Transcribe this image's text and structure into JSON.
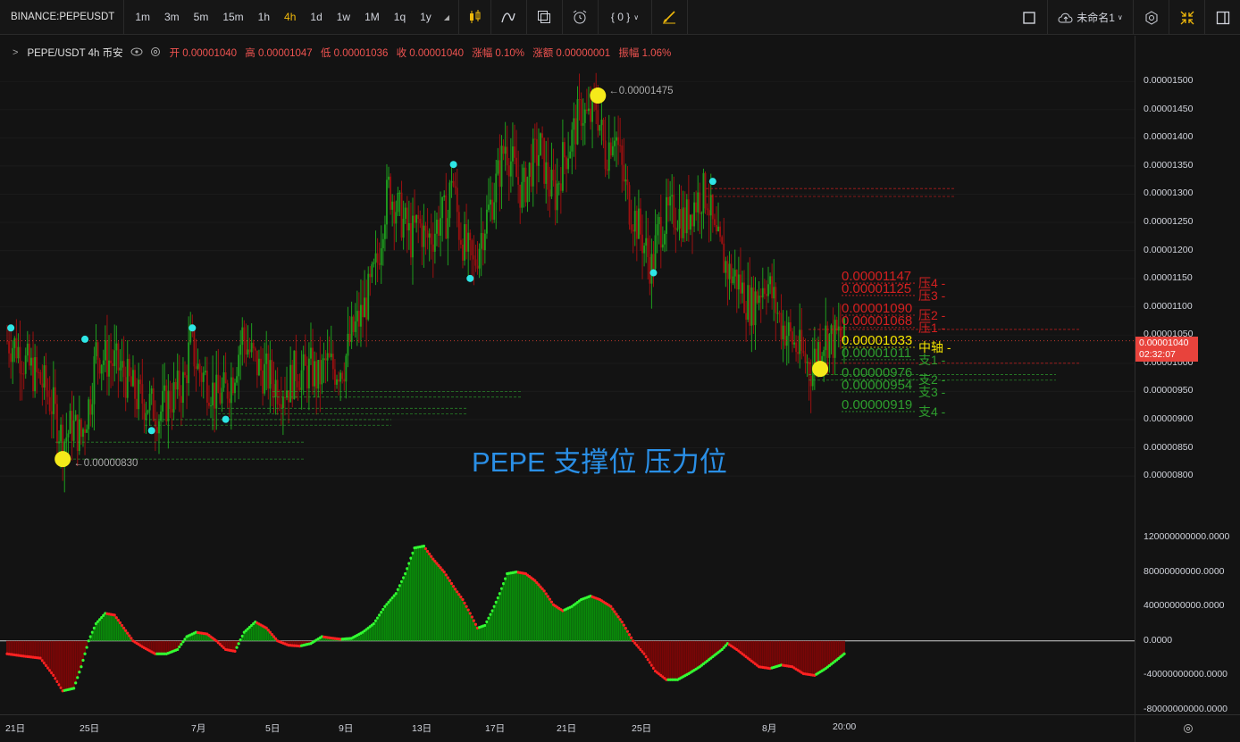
{
  "toolbar": {
    "symbol": "BINANCE:PEPEUSDT",
    "intervals": [
      "1m",
      "3m",
      "5m",
      "15m",
      "1h",
      "4h",
      "1d",
      "1w",
      "1M",
      "1q",
      "1y"
    ],
    "active_interval": "4h",
    "indicator_count": "{ 0 }",
    "layout_name": "未命名1"
  },
  "legend": {
    "title": "PEPE/USDT 4h 币安",
    "open": "开 0.00001040",
    "high": "高 0.00001047",
    "low": "低 0.00001036",
    "close": "收 0.00001040",
    "change": "涨幅 0.10%",
    "amount": "涨额 0.00000001",
    "amplitude": "振幅 1.06%"
  },
  "colors": {
    "up": "#1e9e1e",
    "down": "#9b1010",
    "resistance": "#d42020",
    "support": "#2e9e2e",
    "pivot": "#f5e400",
    "marker_cyan": "#2ee6e6",
    "marker_yellow": "#f5ea1a",
    "watermark": "#2a8fe6"
  },
  "watermark": "PEPE   支撑位  压力位",
  "current_price": {
    "value": "0.00001040",
    "countdown": "02:32:07"
  },
  "chart_data": [
    {
      "type": "candlestick",
      "yaxis_ticks": [
        "0.00001500",
        "0.00001450",
        "0.00001400",
        "0.00001350",
        "0.00001300",
        "0.00001250",
        "0.00001200",
        "0.00001150",
        "0.00001100",
        "0.00001050",
        "0.00001000",
        "0.00000950",
        "0.00000900",
        "0.00000850",
        "0.00000800"
      ],
      "ylim": [
        7.7e-06,
        1.54e-05
      ],
      "xaxis_ticks": [
        "21日",
        "25日",
        "7月",
        "5日",
        "9日",
        "13日",
        "17日",
        "21日",
        "25日",
        "8月",
        "20:00"
      ],
      "close_path": [
        [
          0,
          1.04e-05
        ],
        [
          5,
          1.03e-05
        ],
        [
          10,
          1e-05
        ],
        [
          15,
          9.8e-06
        ],
        [
          20,
          9.6e-06
        ],
        [
          25,
          9.2e-06
        ],
        [
          30,
          8.6e-06
        ],
        [
          35,
          8.9e-06
        ],
        [
          40,
          8.7e-06
        ],
        [
          45,
          9.4e-06
        ],
        [
          48,
          1.02e-05
        ],
        [
          52,
          1.01e-05
        ],
        [
          58,
          1e-05
        ],
        [
          63,
          9.8e-06
        ],
        [
          70,
          9.4e-06
        ],
        [
          76,
          9.3e-06
        ],
        [
          82,
          9.1e-06
        ],
        [
          86,
          9.3e-06
        ],
        [
          92,
          9.5e-06
        ],
        [
          96,
          9.7e-06
        ],
        [
          99,
          1.04e-05
        ],
        [
          103,
          9.9e-06
        ],
        [
          108,
          9.7e-06
        ],
        [
          113,
          9.4e-06
        ],
        [
          118,
          9.5e-06
        ],
        [
          122,
          9.8e-06
        ],
        [
          127,
          1.05e-05
        ],
        [
          131,
          1.02e-05
        ],
        [
          136,
          9.9e-06
        ],
        [
          140,
          9.8e-06
        ],
        [
          146,
          9.6e-06
        ],
        [
          152,
          9.6e-06
        ],
        [
          156,
          9.9e-06
        ],
        [
          160,
          9.8e-06
        ],
        [
          164,
          9.9e-06
        ],
        [
          168,
          9.7e-06
        ],
        [
          172,
          1e-05
        ],
        [
          177,
          9.9e-06
        ],
        [
          182,
          1e-05
        ],
        [
          186,
          1.05e-05
        ],
        [
          192,
          1.09e-05
        ],
        [
          196,
          1.13e-05
        ],
        [
          200,
          1.18e-05
        ],
        [
          203,
          1.26e-05
        ],
        [
          206,
          1.31e-05
        ],
        [
          210,
          1.28e-05
        ],
        [
          214,
          1.25e-05
        ],
        [
          218,
          1.22e-05
        ],
        [
          222,
          1.25e-05
        ],
        [
          226,
          1.22e-05
        ],
        [
          230,
          1.23e-05
        ],
        [
          234,
          1.26e-05
        ],
        [
          238,
          1.26e-05
        ],
        [
          240,
          1.34e-05
        ],
        [
          244,
          1.24e-05
        ],
        [
          248,
          1.2e-05
        ],
        [
          252,
          1.17e-05
        ],
        [
          256,
          1.23e-05
        ],
        [
          261,
          1.28e-05
        ],
        [
          265,
          1.33e-05
        ],
        [
          269,
          1.39e-05
        ],
        [
          273,
          1.35e-05
        ],
        [
          278,
          1.3e-05
        ],
        [
          284,
          1.36e-05
        ],
        [
          288,
          1.38e-05
        ],
        [
          292,
          1.32e-05
        ],
        [
          296,
          1.3e-05
        ],
        [
          300,
          1.36e-05
        ],
        [
          305,
          1.4e-05
        ],
        [
          310,
          1.45e-05
        ],
        [
          314,
          1.43e-05
        ],
        [
          318,
          1.46e-05
        ],
        [
          323,
          1.37e-05
        ],
        [
          328,
          1.42e-05
        ],
        [
          332,
          1.34e-05
        ],
        [
          336,
          1.28e-05
        ],
        [
          340,
          1.25e-05
        ],
        [
          344,
          1.21e-05
        ],
        [
          348,
          1.17e-05
        ],
        [
          352,
          1.24e-05
        ],
        [
          357,
          1.26e-05
        ],
        [
          362,
          1.27e-05
        ],
        [
          366,
          1.25e-05
        ],
        [
          370,
          1.28e-05
        ],
        [
          375,
          1.3e-05
        ],
        [
          378,
          1.3e-05
        ],
        [
          382,
          1.22e-05
        ],
        [
          386,
          1.19e-05
        ],
        [
          390,
          1.16e-05
        ],
        [
          394,
          1.15e-05
        ],
        [
          398,
          1.12e-05
        ],
        [
          402,
          1.1e-05
        ],
        [
          406,
          1.13e-05
        ],
        [
          410,
          1.15e-05
        ],
        [
          414,
          1.11e-05
        ],
        [
          418,
          1.07e-05
        ],
        [
          422,
          1.05e-05
        ],
        [
          426,
          1.03e-05
        ],
        [
          430,
          1.01e-05
        ],
        [
          434,
          9.9e-06
        ],
        [
          438,
          1.03e-05
        ],
        [
          442,
          1.05e-05
        ],
        [
          446,
          1.04e-05
        ],
        [
          449,
          1.05e-05
        ],
        [
          452,
          1.04e-05
        ]
      ],
      "candle_count": 453,
      "annotations": {
        "low": {
          "label": "0.00000830",
          "index": 30,
          "value": 8.3e-06
        },
        "high": {
          "label": "0.00001475",
          "index": 319,
          "value": 1.475e-05
        }
      },
      "swing_markers": {
        "yellow": [
          [
            30,
            8.3e-06
          ],
          [
            319,
            1.475e-05
          ],
          [
            439,
            9.9e-06
          ]
        ],
        "cyan_top": [
          [
            2,
            1.05e-05
          ],
          [
            42,
            1.03e-05
          ],
          [
            100,
            1.05e-05
          ],
          [
            241,
            1.34e-05
          ],
          [
            381,
            1.31e-05
          ]
        ],
        "cyan_bottom": [
          [
            78,
            8.9e-06
          ],
          [
            118,
            9.1e-06
          ],
          [
            250,
            1.16e-05
          ],
          [
            349,
            1.17e-05
          ]
        ]
      },
      "levels": [
        {
          "label": "压4",
          "value": "0.00001147",
          "price": 1.147e-05,
          "kind": "resistance"
        },
        {
          "label": "压3",
          "value": "0.00001125",
          "price": 1.125e-05,
          "kind": "resistance"
        },
        {
          "label": "压2",
          "value": "0.00001090",
          "price": 1.09e-05,
          "kind": "resistance"
        },
        {
          "label": "压1",
          "value": "0.00001068",
          "price": 1.068e-05,
          "kind": "resistance"
        },
        {
          "label": "中轴",
          "value": "0.00001033",
          "price": 1.033e-05,
          "kind": "pivot"
        },
        {
          "label": "支1",
          "value": "0.00001011",
          "price": 1.011e-05,
          "kind": "support"
        },
        {
          "label": "支2",
          "value": "0.00000976",
          "price": 9.76e-06,
          "kind": "support"
        },
        {
          "label": "支3",
          "value": "0.00000954",
          "price": 9.54e-06,
          "kind": "support"
        },
        {
          "label": "支4",
          "value": "0.00000919",
          "price": 9.19e-06,
          "kind": "support"
        }
      ]
    },
    {
      "type": "bar",
      "name": "MACD histogram",
      "yaxis_ticks": [
        "120000000000.0000",
        "80000000000.0000",
        "40000000000.0000",
        "0.0000",
        "-40000000000.0000",
        "-80000000000.0000"
      ],
      "ylim": [
        -80000000000,
        120000000000
      ],
      "histogram_path": [
        [
          0,
          -15
        ],
        [
          10,
          -18
        ],
        [
          18,
          -20
        ],
        [
          25,
          -40
        ],
        [
          30,
          -58
        ],
        [
          36,
          -55
        ],
        [
          40,
          -30
        ],
        [
          44,
          0
        ],
        [
          48,
          20
        ],
        [
          53,
          32
        ],
        [
          58,
          30
        ],
        [
          63,
          15
        ],
        [
          68,
          0
        ],
        [
          74,
          -8
        ],
        [
          80,
          -15
        ],
        [
          86,
          -15
        ],
        [
          92,
          -10
        ],
        [
          97,
          5
        ],
        [
          102,
          10
        ],
        [
          108,
          8
        ],
        [
          113,
          0
        ],
        [
          118,
          -10
        ],
        [
          123,
          -12
        ],
        [
          128,
          10
        ],
        [
          134,
          22
        ],
        [
          140,
          15
        ],
        [
          146,
          0
        ],
        [
          152,
          -5
        ],
        [
          158,
          -6
        ],
        [
          164,
          -3
        ],
        [
          170,
          5
        ],
        [
          176,
          3
        ],
        [
          180,
          2
        ],
        [
          186,
          3
        ],
        [
          192,
          10
        ],
        [
          198,
          20
        ],
        [
          204,
          40
        ],
        [
          210,
          55
        ],
        [
          215,
          78
        ],
        [
          220,
          108
        ],
        [
          225,
          110
        ],
        [
          230,
          95
        ],
        [
          236,
          80
        ],
        [
          242,
          60
        ],
        [
          246,
          48
        ],
        [
          250,
          32
        ],
        [
          254,
          15
        ],
        [
          258,
          18
        ],
        [
          262,
          35
        ],
        [
          266,
          55
        ],
        [
          270,
          78
        ],
        [
          275,
          80
        ],
        [
          280,
          78
        ],
        [
          285,
          70
        ],
        [
          290,
          58
        ],
        [
          295,
          42
        ],
        [
          300,
          35
        ],
        [
          305,
          40
        ],
        [
          310,
          48
        ],
        [
          315,
          52
        ],
        [
          320,
          48
        ],
        [
          326,
          40
        ],
        [
          332,
          22
        ],
        [
          338,
          0
        ],
        [
          344,
          -15
        ],
        [
          350,
          -35
        ],
        [
          356,
          -45
        ],
        [
          362,
          -45
        ],
        [
          368,
          -38
        ],
        [
          374,
          -30
        ],
        [
          380,
          -20
        ],
        [
          386,
          -10
        ],
        [
          389,
          -3
        ],
        [
          394,
          -10
        ],
        [
          400,
          -20
        ],
        [
          406,
          -30
        ],
        [
          412,
          -32
        ],
        [
          418,
          -28
        ],
        [
          424,
          -30
        ],
        [
          430,
          -38
        ],
        [
          436,
          -40
        ],
        [
          442,
          -32
        ],
        [
          448,
          -22
        ],
        [
          452,
          -15
        ]
      ]
    }
  ]
}
